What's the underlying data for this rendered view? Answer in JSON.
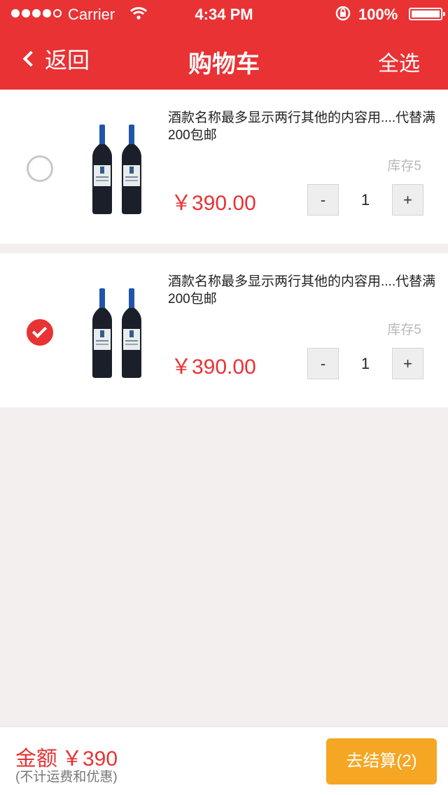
{
  "status_bar": {
    "carrier": "Carrier",
    "time": "4:34 PM",
    "battery": "100%"
  },
  "nav": {
    "back_label": "返回",
    "title": "购物车",
    "select_all": "全选"
  },
  "cart_items": [
    {
      "name": "酒款名称最多显示两行其他的内容用....代替满200包邮",
      "stock": "库存5",
      "price": "￥390.00",
      "quantity": "1",
      "minus_label": "-",
      "plus_label": "+",
      "checked": false
    },
    {
      "name": "酒款名称最多显示两行其他的内容用....代替满200包邮",
      "stock": "库存5",
      "price": "￥390.00",
      "quantity": "1",
      "minus_label": "-",
      "plus_label": "+",
      "checked": true
    }
  ],
  "footer": {
    "total_label": "金额",
    "total_value": "￥390",
    "note": "(不计运费和优惠)",
    "checkout_label": "去结算(2)"
  },
  "colors": {
    "primary": "#e93234",
    "checkout": "#f5a623",
    "background": "#f4efef"
  }
}
